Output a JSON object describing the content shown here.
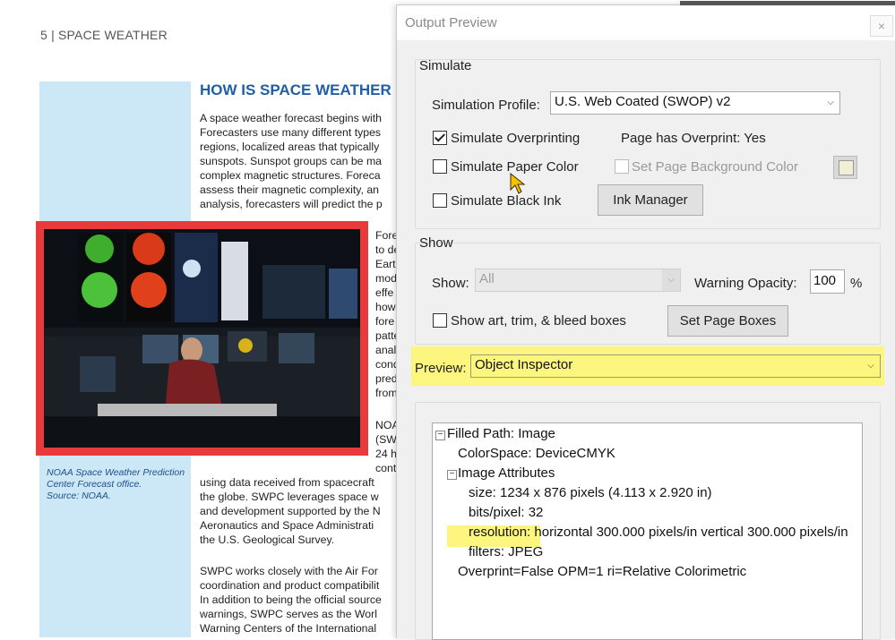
{
  "document": {
    "header": "5  |  SPACE WEATHER",
    "title": "HOW IS SPACE WEATHER",
    "para1": [
      "A space weather forecast begins with",
      "Forecasters use many different types",
      "regions, localized areas that typically",
      "sunspots. Sunspot groups can be ma",
      "complex magnetic structures. Foreca",
      "assess their magnetic complexity, an",
      "analysis, forecasters will predict the p"
    ],
    "side_col": [
      "Fore",
      "to de",
      "Eart",
      "mod",
      "effe",
      "how",
      "fore",
      "patte",
      "anal",
      "cond",
      "pred",
      "from"
    ],
    "side_col2": [
      "NOA",
      "(SW",
      "24 h",
      "cont"
    ],
    "para2": [
      "using data received from spacecraft",
      "the globe. SWPC leverages space w",
      "and development supported by the N",
      "Aeronautics and Space Administrati",
      "the U.S. Geological Survey."
    ],
    "para3": [
      "SWPC works closely with the Air For",
      "coordination and product compatibilit",
      "In addition to being the official source",
      "warnings, SWPC serves as the Worl",
      "Warning Centers of the International"
    ],
    "caption": [
      "NOAA Space Weather Prediction",
      "Center Forecast office.",
      "Source: NOAA."
    ]
  },
  "dialog": {
    "title": "Output Preview",
    "close_glyph": "×",
    "simulate": {
      "heading": "Simulate",
      "profile_label": "Simulation Profile:",
      "profile_value": "U.S. Web Coated (SWOP) v2",
      "overprinting_label": "Simulate Overprinting",
      "overprinting_checked": true,
      "page_overprint": "Page has Overprint:  Yes",
      "paper_color_label": "Simulate Paper Color",
      "page_bg_label": "Set Page Background Color",
      "black_ink_label": "Simulate Black Ink",
      "ink_manager": "Ink Manager"
    },
    "show": {
      "heading": "Show",
      "show_label": "Show:",
      "show_value": "All",
      "opacity_label": "Warning Opacity:",
      "opacity_value": "100",
      "opacity_unit": "%",
      "boxes_label": "Show art, trim, & bleed boxes",
      "set_boxes": "Set Page Boxes"
    },
    "preview": {
      "label": "Preview:",
      "value": "Object Inspector"
    },
    "inspector": {
      "filled_path": "Filled Path: Image",
      "colorspace": "ColorSpace: DeviceCMYK",
      "image_attributes": "Image Attributes",
      "size": "size: 1234 x 876 pixels (4.113 x 2.920 in)",
      "bits": "bits/pixel: 32",
      "resolution_key": "resolution:",
      "resolution_value": " horizontal 300.000 pixels/in vertical 300.000 pixels/in",
      "filters": "filters: JPEG",
      "overprint": "Overprint=False OPM=1 ri=Relative Colorimetric"
    }
  },
  "colors": {
    "highlight": "#fcf67e",
    "sidebar_band": "#cce8f6",
    "photo_frame": "#e8393b",
    "title_blue": "#1f5fa8"
  }
}
